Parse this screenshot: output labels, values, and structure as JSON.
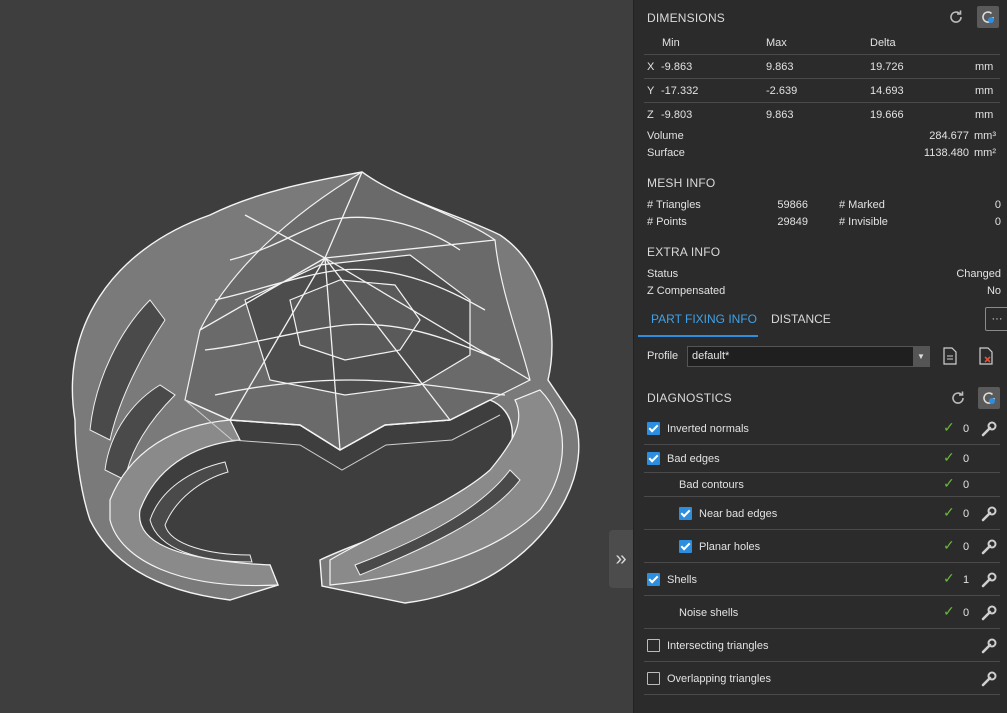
{
  "dimensions": {
    "title": "DIMENSIONS",
    "headers": {
      "min": "Min",
      "max": "Max",
      "delta": "Delta"
    },
    "rows": [
      {
        "axis": "X",
        "min": "-9.863",
        "max": "9.863",
        "delta": "19.726",
        "unit": "mm"
      },
      {
        "axis": "Y",
        "min": "-17.332",
        "max": "-2.639",
        "delta": "14.693",
        "unit": "mm"
      },
      {
        "axis": "Z",
        "min": "-9.803",
        "max": "9.863",
        "delta": "19.666",
        "unit": "mm"
      }
    ],
    "volume_label": "Volume",
    "volume_value": "284.677",
    "volume_unit": "mm³",
    "surface_label": "Surface",
    "surface_value": "1138.480",
    "surface_unit": "mm²"
  },
  "mesh_info": {
    "title": "MESH INFO",
    "triangles_label": "# Triangles",
    "triangles_value": "59866",
    "points_label": "# Points",
    "points_value": "29849",
    "marked_label": "# Marked",
    "marked_value": "0",
    "invisible_label": "# Invisible",
    "invisible_value": "0"
  },
  "extra_info": {
    "title": "EXTRA INFO",
    "status_label": "Status",
    "status_value": "Changed",
    "zcomp_label": "Z Compensated",
    "zcomp_value": "No"
  },
  "tabs": [
    {
      "label": "PART FIXING INFO",
      "active": true
    },
    {
      "label": "DISTANCE",
      "active": false
    }
  ],
  "more_label": "···",
  "profile": {
    "label": "Profile",
    "value": "default*"
  },
  "diagnostics": {
    "title": "DIAGNOSTICS",
    "items": [
      {
        "label": "Inverted normals",
        "checkbox": true,
        "checked": true,
        "ok": true,
        "count": "0",
        "wrench": true
      },
      {
        "label": "Bad edges",
        "checkbox": true,
        "checked": true,
        "ok": true,
        "count": "0",
        "wrench": false
      },
      {
        "label": "Bad contours",
        "checkbox": false,
        "checked": false,
        "ok": true,
        "count": "0",
        "wrench": false
      },
      {
        "label": "Near bad edges",
        "checkbox": true,
        "checked": true,
        "ok": true,
        "count": "0",
        "wrench": true
      },
      {
        "label": "Planar holes",
        "checkbox": true,
        "checked": true,
        "ok": true,
        "count": "0",
        "wrench": true
      },
      {
        "label": "Shells",
        "checkbox": true,
        "checked": true,
        "ok": true,
        "count": "1",
        "wrench": true
      },
      {
        "label": "Noise shells",
        "checkbox": false,
        "checked": false,
        "ok": true,
        "count": "0",
        "wrench": true
      },
      {
        "label": "Intersecting triangles",
        "checkbox": true,
        "checked": false,
        "ok": false,
        "count": "",
        "wrench": true
      },
      {
        "label": "Overlapping triangles",
        "checkbox": true,
        "checked": false,
        "ok": false,
        "count": "",
        "wrench": true
      }
    ]
  },
  "colors": {
    "accent": "#2d8ee0",
    "ok_green": "#6ab83a",
    "panel_bg": "#2b2b2b",
    "viewport_bg": "#3e3e3e"
  }
}
